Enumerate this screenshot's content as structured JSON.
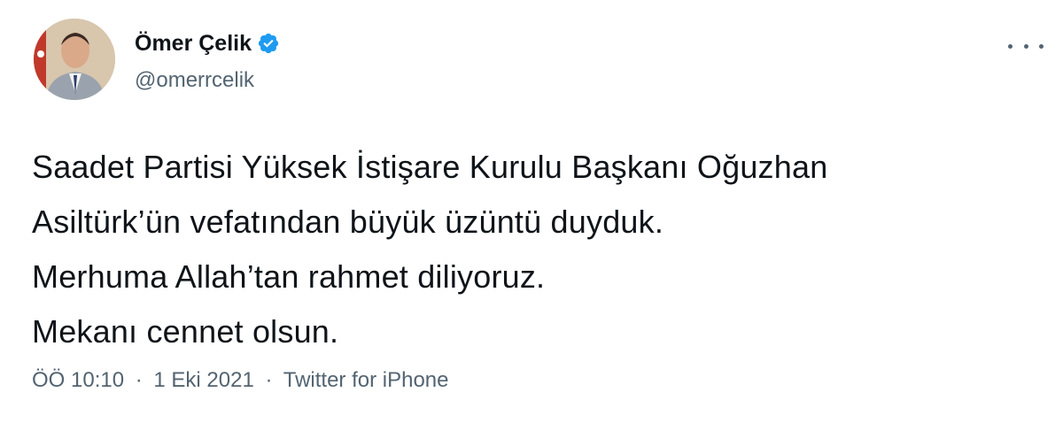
{
  "author": {
    "display_name": "Ömer Çelik",
    "handle": "@omerrcelik",
    "verified": true,
    "avatar_icon": "profile-photo"
  },
  "tweet": {
    "lines": [
      "Saadet Partisi Yüksek İstişare Kurulu Başkanı Oğuzhan",
      "Asiltürk’ün vefatından büyük üzüntü duyduk.",
      "Merhuma Allah’tan rahmet diliyoruz.",
      "Mekanı cennet olsun."
    ]
  },
  "meta": {
    "time": "ÖÖ 10:10",
    "separator": "·",
    "date": "1 Eki 2021",
    "source": "Twitter for iPhone"
  },
  "colors": {
    "verified_badge": "#1d9bf0",
    "text_primary": "#0f1419",
    "text_secondary": "#536471"
  },
  "icons": {
    "verified": "verified-badge-icon",
    "more": "more-options-icon"
  }
}
